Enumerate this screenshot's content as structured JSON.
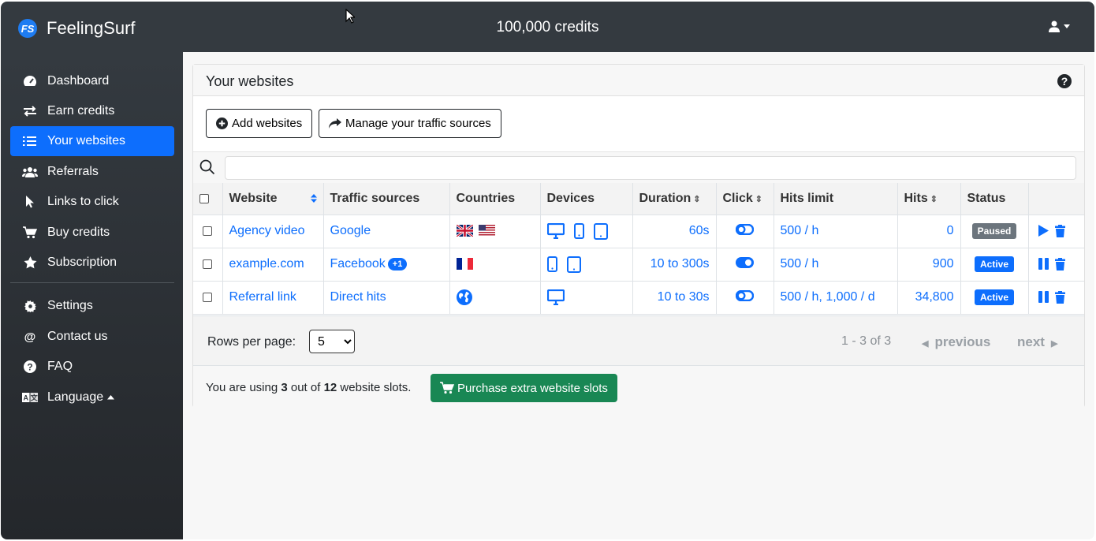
{
  "app": {
    "name": "FeelingSurf",
    "logo_text": "FS"
  },
  "header": {
    "credits": "100,000 credits",
    "user_menu_icon": "user-icon"
  },
  "sidebar": {
    "items": [
      {
        "label": "Dashboard",
        "icon": "tachometer-icon"
      },
      {
        "label": "Earn credits",
        "icon": "exchange-icon"
      },
      {
        "label": "Your websites",
        "icon": "list-icon",
        "active": true
      },
      {
        "label": "Referrals",
        "icon": "users-icon"
      },
      {
        "label": "Links to click",
        "icon": "pointer-icon"
      },
      {
        "label": "Buy credits",
        "icon": "cart-icon"
      },
      {
        "label": "Subscription",
        "icon": "star-icon"
      }
    ],
    "secondary": [
      {
        "label": "Settings",
        "icon": "gear-icon"
      },
      {
        "label": "Contact us",
        "icon": "at-icon"
      },
      {
        "label": "FAQ",
        "icon": "question-icon"
      },
      {
        "label": "Language",
        "icon": "language-icon"
      }
    ]
  },
  "card": {
    "title": "Your websites"
  },
  "actions": {
    "add": "Add websites",
    "manage": "Manage your traffic sources"
  },
  "search": {
    "placeholder": "",
    "value": ""
  },
  "table": {
    "headers": [
      "Website",
      "Traffic sources",
      "Countries",
      "Devices",
      "Duration",
      "Click",
      "Hits limit",
      "Hits",
      "Status"
    ],
    "rows": [
      {
        "website": "Agency video",
        "source": "Google",
        "source_badge": "",
        "countries": [
          "GB",
          "US"
        ],
        "devices": [
          "desktop",
          "mobile",
          "tablet"
        ],
        "duration": "60s",
        "click": "off",
        "hits_limit": "500 / h",
        "hits": "0",
        "status": "Paused",
        "status_color": "#6c757d",
        "action": "play"
      },
      {
        "website": "example.com",
        "source": "Facebook",
        "source_badge": "+1",
        "countries": [
          "FR"
        ],
        "devices": [
          "mobile",
          "tablet"
        ],
        "duration": "10 to 300s",
        "click": "on",
        "hits_limit": "500 / h",
        "hits": "900",
        "status": "Active",
        "status_color": "#0d6efd",
        "action": "pause"
      },
      {
        "website": "Referral link",
        "source": "Direct hits",
        "source_badge": "",
        "countries": [
          "World"
        ],
        "devices": [
          "desktop"
        ],
        "duration": "10 to 30s",
        "click": "off",
        "hits_limit": "500 / h, 1,000 / d",
        "hits": "34,800",
        "status": "Active",
        "status_color": "#0d6efd",
        "action": "pause"
      }
    ]
  },
  "pagination": {
    "rows_label": "Rows per page:",
    "rows_value": "5",
    "range": "1 - 3 of 3",
    "prev": "previous",
    "next": "next"
  },
  "slots": {
    "prefix": "You are using ",
    "used": "3",
    "middle": " out of ",
    "total": "12",
    "suffix": " website slots.",
    "purchase": "Purchase extra website slots"
  },
  "colors": {
    "accent": "#0d6efd",
    "success": "#198754",
    "topbar": "#343a40",
    "paused": "#6c757d"
  }
}
